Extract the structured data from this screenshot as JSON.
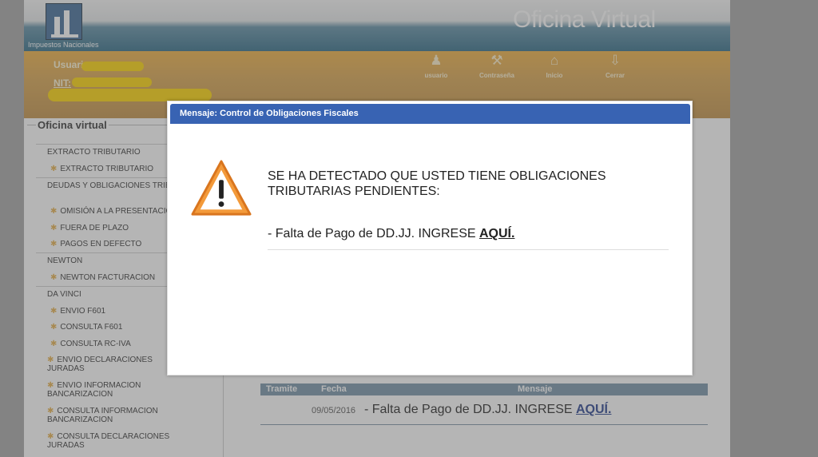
{
  "header": {
    "logo_text": "Impuestos Nacionales",
    "app_title": "Oficina Virtual"
  },
  "userbar": {
    "user_label": "Usuario",
    "nit_label": "NIT:",
    "nav": [
      {
        "label": "usuario",
        "icon": "user-icon"
      },
      {
        "label": "Contraseña",
        "icon": "key-icon"
      },
      {
        "label": "Inicio",
        "icon": "home-icon"
      },
      {
        "label": "Cerrar",
        "icon": "exit-arrow-icon"
      }
    ]
  },
  "sidebar": {
    "title": "Oficina virtual",
    "items": [
      {
        "type": "cat",
        "label": "EXTRACTO TRIBUTARIO"
      },
      {
        "type": "sub",
        "label": "EXTRACTO TRIBUTARIO"
      },
      {
        "type": "cat",
        "label": "DEUDAS Y OBLIGACIONES TRIBUTARIAS"
      },
      {
        "type": "sub",
        "label": "OMISIÓN A LA PRESENTACIÓN"
      },
      {
        "type": "sub",
        "label": "FUERA DE PLAZO"
      },
      {
        "type": "sub",
        "label": "PAGOS EN DEFECTO"
      },
      {
        "type": "cat",
        "label": "NEWTON"
      },
      {
        "type": "sub",
        "label": "NEWTON FACTURACION"
      },
      {
        "type": "cat",
        "label": "DA VINCI"
      },
      {
        "type": "sub",
        "label": "ENVIO F601"
      },
      {
        "type": "sub",
        "label": "CONSULTA F601"
      },
      {
        "type": "sub",
        "label": "CONSULTA RC-IVA"
      },
      {
        "type": "sub",
        "label": "ENVIO DECLARACIONES JURADAS"
      },
      {
        "type": "sub",
        "label": "ENVIO INFORMACION BANCARIZACION"
      },
      {
        "type": "sub",
        "label": "CONSULTA INFORMACION BANCARIZACION"
      },
      {
        "type": "sub",
        "label": "CONSULTA DECLARACIONES JURADAS"
      }
    ]
  },
  "table": {
    "headers": [
      "Tramite",
      "Fecha",
      "Mensaje"
    ],
    "rows": [
      {
        "tramite": "",
        "fecha": "09/05/2016",
        "mensaje": "- Falta de Pago de DD.JJ. INGRESE",
        "link": "AQUÍ."
      }
    ]
  },
  "modal": {
    "title": "Mensaje: Control de Obligaciones Fiscales",
    "icon": "warning-icon",
    "message": "SE HA DETECTADO QUE USTED TIENE OBLIGACIONES TRIBUTARIAS PENDIENTES:",
    "item_text": "- Falta de Pago de DD.JJ. INGRESE",
    "item_link": "AQUÍ."
  },
  "colors": {
    "header_blue": "#2f6b86",
    "userbar_orange": "#d9a44c",
    "modal_header": "#3863b3",
    "table_header": "#7593a8"
  }
}
